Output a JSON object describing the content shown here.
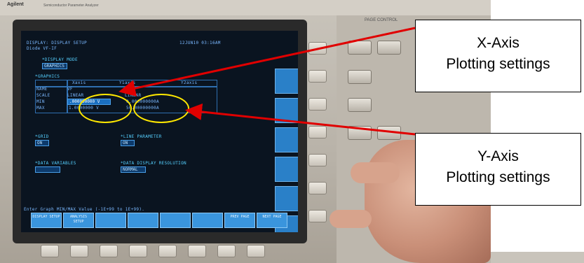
{
  "device": {
    "brand": "Agilent",
    "model": "Semiconductor Parameter Analyzer",
    "panel_label": "PAGE CONTROL"
  },
  "screen": {
    "title": "DISPLAY: DISPLAY SETUP",
    "timestamp": "12JUN10 03:16AM",
    "subtitle": "Diode VF-IF",
    "display_mode_label": "*DISPLAY MODE",
    "display_mode_value": "GRAPHICS",
    "graphics_label": "*GRAPHICS",
    "graphics_table": {
      "headers": [
        "",
        "Xaxis",
        "Y1axis",
        "Y2axis"
      ],
      "rows": [
        {
          "label": "NAME",
          "x": "VF",
          "y1": "IF",
          "y2": ""
        },
        {
          "label": "SCALE",
          "x": "LINEAR",
          "y1": "LINEAR",
          "y2": ""
        },
        {
          "label": "MIN",
          "x": ".000000000 V",
          "y1": "0.000000000A",
          "y2": ""
        },
        {
          "label": "MAX",
          "x": "1.0000000 V",
          "y1": "50.00000000A",
          "y2": ""
        }
      ]
    },
    "grid_label": "*GRID",
    "grid_value": "ON",
    "line_param_label": "*LINE PARAMETER",
    "line_param_value": "ON",
    "data_variables_label": "*DATA VARIABLES",
    "data_variables_value": "",
    "data_resolution_label": "*DATA DISPLAY RESOLUTION",
    "data_resolution_value": "NORMAL",
    "prompt": "Enter Graph MIN/MAX Value (-1E+99 to 1E+99).",
    "bottom_keys": [
      "DISPLAY SETUP",
      "ANALYSIS SETUP",
      "",
      "",
      "",
      "",
      "PREV PAGE",
      "NEXT PAGE"
    ]
  },
  "callouts": {
    "x_axis": {
      "line1": "X-Axis",
      "line2": "Plotting settings"
    },
    "y_axis": {
      "line1": "Y-Axis",
      "line2": "Plotting settings"
    }
  },
  "colors": {
    "screen_bg": "#0a1420",
    "screen_text": "#7ab8ff",
    "softkey": "#2a80c8",
    "highlight_ellipse": "#ffe800",
    "arrow": "#e00000"
  }
}
